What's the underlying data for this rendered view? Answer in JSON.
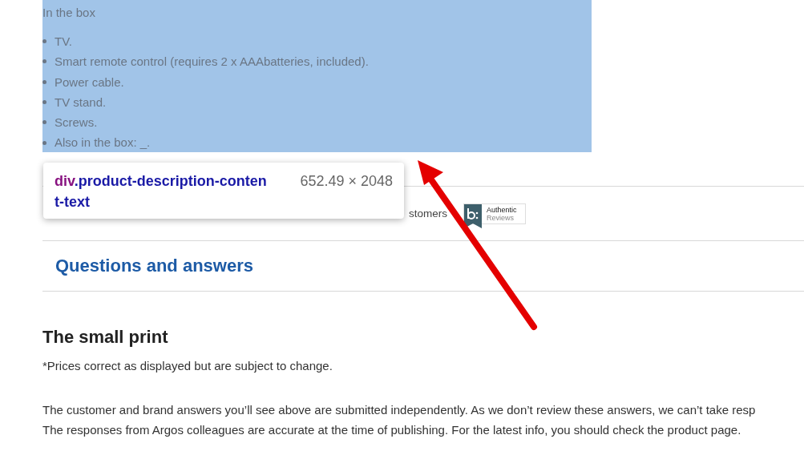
{
  "description": {
    "heading": "In the box",
    "highlighted": true,
    "items": [
      "TV.",
      "Smart remote control (requires 2 x AAAbatteries, included).",
      "Power cable.",
      "TV stand.",
      "Screws.",
      "Also in the box: _."
    ]
  },
  "inspector_tooltip": {
    "tag": "div",
    "class_name": ".product-description-conten",
    "class_name_wrap": "t-text",
    "size": "652.49 × 2048"
  },
  "reviews": {
    "text": "stomers",
    "badge": {
      "line_1": "Authentic",
      "line_2": "Reviews"
    }
  },
  "questions": {
    "title": "Questions and answers"
  },
  "small_print": {
    "title": "The small print",
    "paragraphs": [
      "*Prices correct as displayed but are subject to change.",
      "The customer and brand answers you’ll see above are submitted independently. As we don’t review these answers, we can’t take resp",
      "The responses from Argos colleagues are accurate at the time of publishing. For the latest info, you should check the product page."
    ]
  },
  "annotation": {
    "kind": "arrow"
  }
}
